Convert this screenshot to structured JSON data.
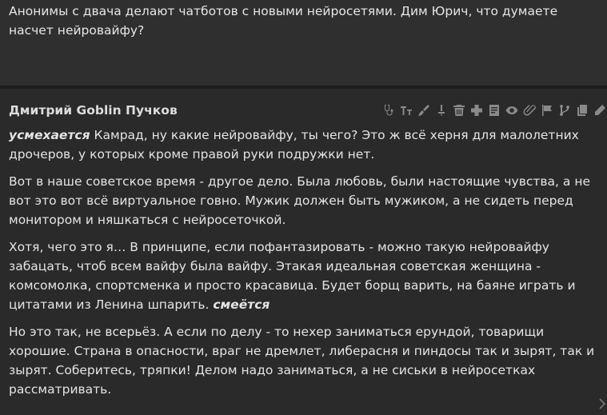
{
  "previous_message": {
    "text": "Анонимы с двача делают чатботов с новыми нейросетями. Дим Юрич, что думаете насчет нейровайфу?"
  },
  "message": {
    "author": "Дмитрий Goblin Пучков",
    "paragraphs": [
      {
        "action": "усмехается",
        "text": " Камрад, ну какие нейровайфу, ты чего? Это ж всё херня для малолетних дрочеров, у которых кроме правой руки подружки нет."
      },
      {
        "text": "Вот в наше советское время - другое дело. Была любовь, были настоящие чувства, а не вот это вот всё виртуальное говно. Мужик должен быть мужиком, а не сидеть перед монитором и няшкаться с нейросеточкой."
      },
      {
        "text": "Хотя, чего это я… В принципе, если пофантазировать - можно такую нейровайфу забацать, чтоб всем вайфу была вайфу. Этакая идеальная советская женщина - комсомолка, спортсменка и просто красавица. Будет борщ варить, на баяне играть и цитатами из Ленина шпарить. ",
        "action_end": "смеётся"
      },
      {
        "text": "Но это так, не всерьёз. А если по делу - то нехер заниматься ерундой, товарищи хорошие. Страна в опасности, враг не дремлет, либерасня и пиндосы так и зырят, так и зырят. Соберитесь, тряпки! Делом надо заниматься, а не сиськи в нейросетках рассматривать."
      }
    ]
  },
  "toolbar_icons": [
    "stethoscope-icon",
    "text-size-icon",
    "brush-icon",
    "pin-icon",
    "trash-icon",
    "add-icon",
    "note-icon",
    "eye-icon",
    "attach-icon",
    "flag-icon",
    "branch-icon",
    "copy-icon",
    "edit-icon"
  ]
}
